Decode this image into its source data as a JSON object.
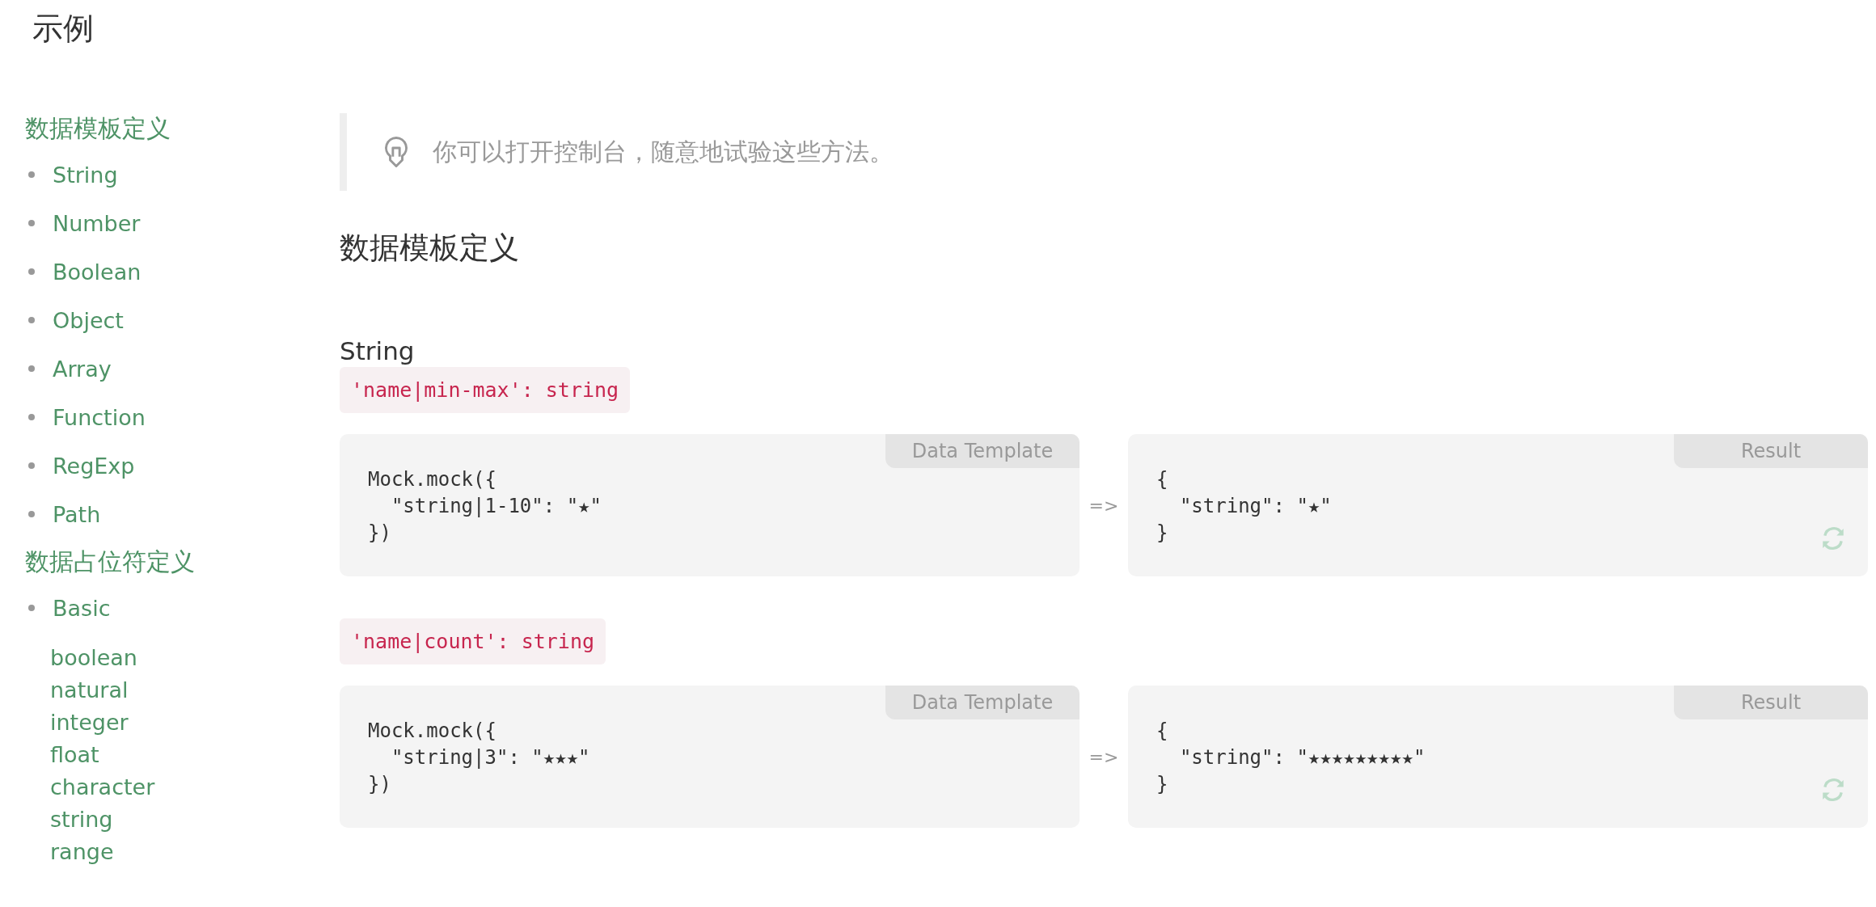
{
  "page_title": "示例",
  "sidebar": {
    "groups": [
      {
        "heading": "数据模板定义",
        "items": [
          {
            "label": "String"
          },
          {
            "label": "Number"
          },
          {
            "label": "Boolean"
          },
          {
            "label": "Object"
          },
          {
            "label": "Array"
          },
          {
            "label": "Function"
          },
          {
            "label": "RegExp"
          },
          {
            "label": "Path"
          }
        ]
      },
      {
        "heading": "数据占位符定义",
        "items": [
          {
            "label": "Basic",
            "children": [
              {
                "label": "boolean"
              },
              {
                "label": "natural"
              },
              {
                "label": "integer"
              },
              {
                "label": "float"
              },
              {
                "label": "character"
              },
              {
                "label": "string"
              },
              {
                "label": "range"
              }
            ]
          }
        ]
      }
    ]
  },
  "tip": "你可以打开控制台，随意地试验这些方法。",
  "section_heading": "数据模板定义",
  "subsection_heading": "String",
  "examples": [
    {
      "rule": "'name|min-max': string",
      "template_label": "Data Template",
      "template_code": "Mock.mock({\n  \"string|1-10\": \"★\"\n})",
      "arrow": "=>",
      "result_label": "Result",
      "result_code": "{\n  \"string\": \"★\"\n}"
    },
    {
      "rule": "'name|count': string",
      "template_label": "Data Template",
      "template_code": "Mock.mock({\n  \"string|3\": \"★★★\"\n})",
      "arrow": "=>",
      "result_label": "Result",
      "result_code": "{\n  \"string\": \"★★★★★★★★★\"\n}"
    }
  ]
}
